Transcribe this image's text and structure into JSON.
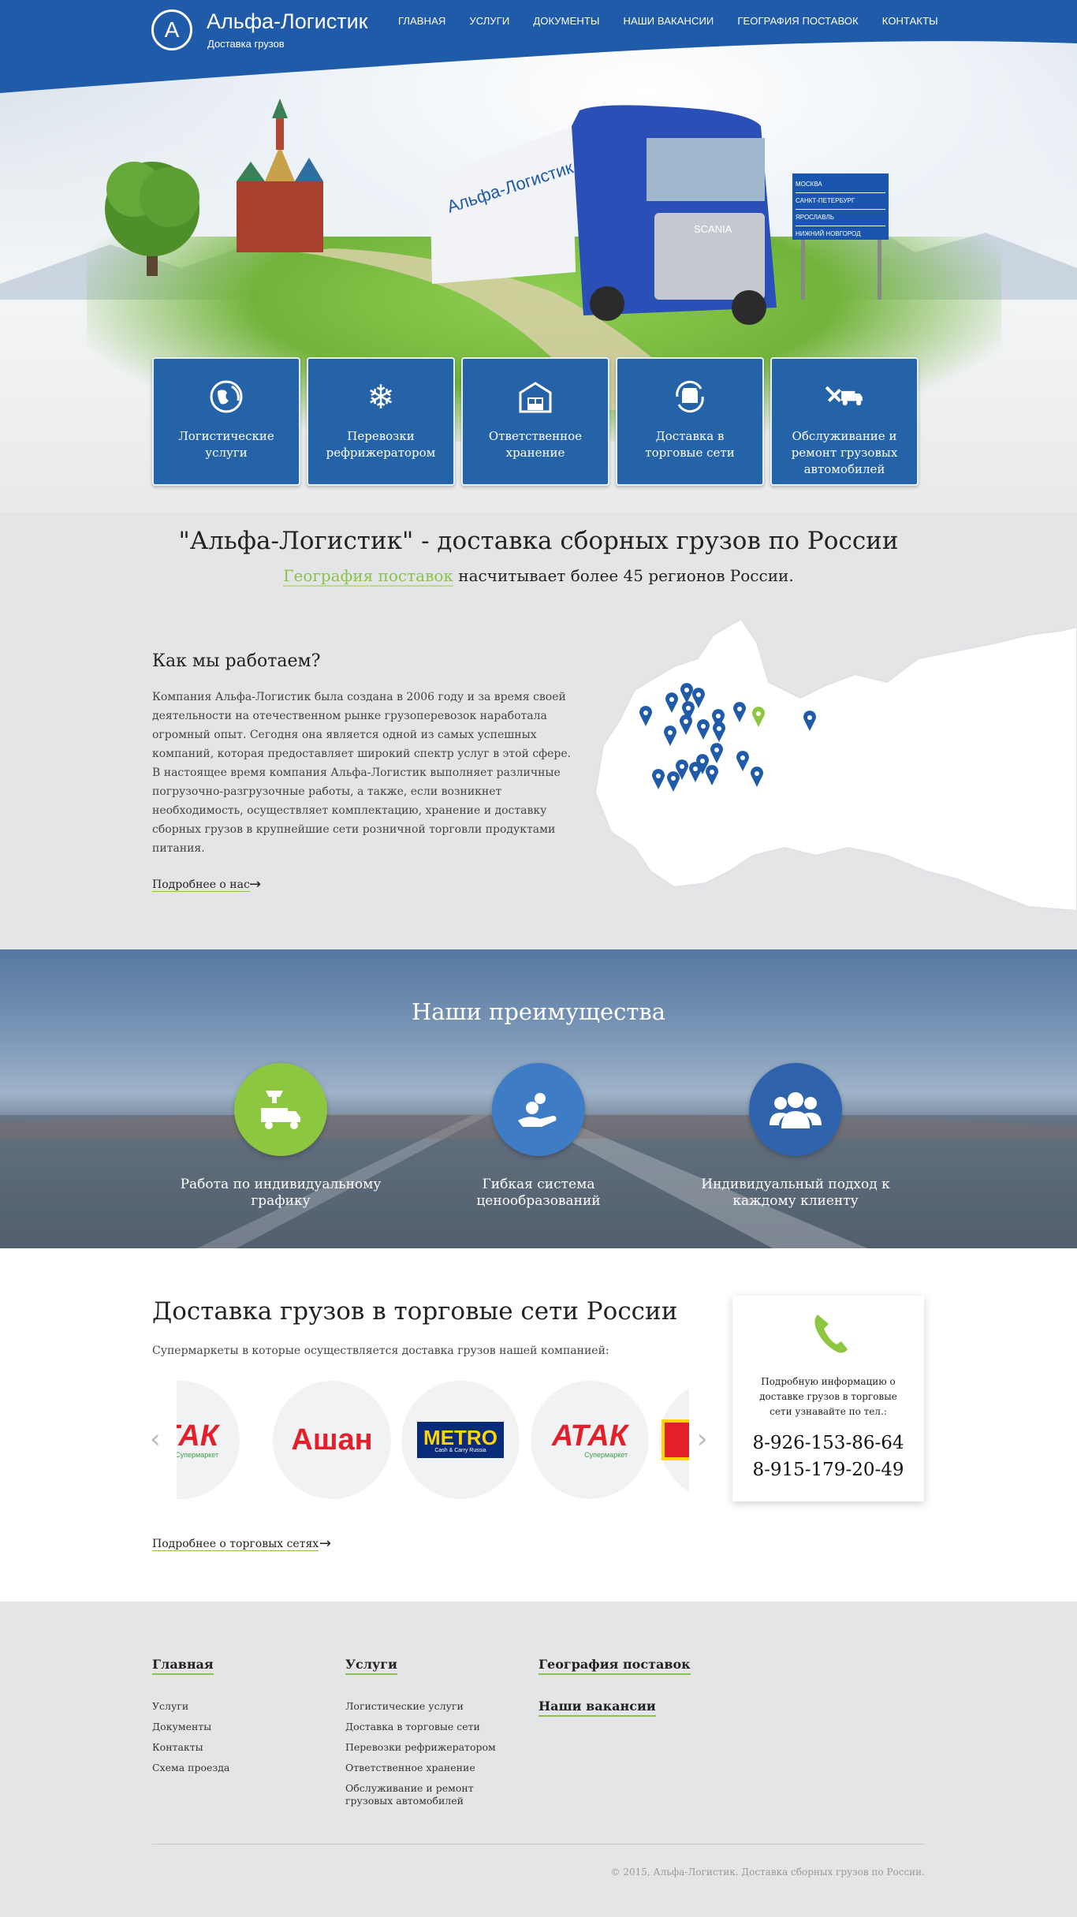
{
  "brand": {
    "name": "Альфа-Логистик",
    "tagline": "Доставка грузов",
    "logo_letter": "A"
  },
  "nav": [
    "ГЛАВНАЯ",
    "УСЛУГИ",
    "ДОКУМЕНТЫ",
    "НАШИ ВАКАНСИИ",
    "ГЕОГРАФИЯ ПОСТАВОК",
    "КОНТАКТЫ"
  ],
  "hero": {
    "truck_brand": "Альфа-Логистик",
    "grille_brand": "SCANIA",
    "signs": [
      "МОСКВА",
      "САНКТ-ПЕТЕРБУРГ",
      "ЯРОСЛАВЛЬ",
      "НИЖНИЙ НОВГОРОД"
    ]
  },
  "services": [
    {
      "label": "Логистические услуги",
      "icon": "globe-icon"
    },
    {
      "label": "Перевозки рефрижератором",
      "icon": "snowflake-icon"
    },
    {
      "label": "Ответственное хранение",
      "icon": "warehouse-icon"
    },
    {
      "label": "Доставка в торговые сети",
      "icon": "store-truck-icon"
    },
    {
      "label": "Обслуживание и ремонт грузовых автомобилей",
      "icon": "repair-truck-icon"
    }
  ],
  "intro": {
    "title": "\"Альфа-Логистик\" - доставка сборных грузов по России",
    "sub_link": "География поставок",
    "sub_rest": " насчитывает более 45 регионов России."
  },
  "how": {
    "title": "Как мы работаем?",
    "text": "Компания Альфа-Логистик была создана в 2006 году и за время своей деятельности на отечественном рынке грузоперевозок наработала огромный опыт. Сегодня она является одной из самых успешных компаний, которая предоставляет широкий спектр услуг в этой сфере. В настоящее время компания Альфа-Логистик выполняет различные погрузочно-разгрузочные работы, а также, если возникнет необходимость, осуществляет комплектацию, хранение и доставку сборных грузов в крупнейшие сети розничной торговли продуктами питания.",
    "more": "Подробнее о нас"
  },
  "advantages": {
    "title": "Наши преимущества",
    "items": [
      {
        "label": "Работа по индивидуальному графику",
        "icon": "schedule-truck-icon",
        "color": "#8dc63f"
      },
      {
        "label": "Гибкая система ценообразований",
        "icon": "money-hand-icon",
        "color": "#3f7cc6"
      },
      {
        "label": "Индивидуальный подход к каждому клиенту",
        "icon": "people-icon",
        "color": "#2f64ad"
      }
    ]
  },
  "retail": {
    "title": "Доставка грузов в торговые сети России",
    "subtitle": "Супермаркеты в которые осуществляется доставка грузов нашей компанией:",
    "logos": [
      {
        "name": "АТАК",
        "caption": "Супермаркет"
      },
      {
        "name": "Ашан"
      },
      {
        "name": "METRO",
        "caption": "Cash & Carry Russia"
      },
      {
        "name": "АТАК",
        "caption": "Супермаркет"
      }
    ],
    "more": "Подробнее о торговых сетях",
    "card_text": "Подробную информацию о доставке грузов в торговые сети узнавайте по тел.:",
    "phones": [
      "8-926-153-86-64",
      "8-915-179-20-49"
    ]
  },
  "footer": {
    "col1": {
      "title": "Главная",
      "items": [
        "Услуги",
        "Документы",
        "Контакты",
        "Схема проезда"
      ]
    },
    "col2": {
      "title": "Услуги",
      "items": [
        "Логистические услуги",
        "Доставка в торговые сети",
        "Перевозки рефрижератором",
        "Ответственное хранение",
        "Обслуживание и ремонт грузовых автомобилей"
      ]
    },
    "col3": {
      "title": "География поставок",
      "title2": "Наши вакансии"
    },
    "copyright": "© 2015, Альфа-Логистик. Доставка сборных грузов по России."
  },
  "colors": {
    "brand_blue": "#2563a8",
    "accent_green": "#8bc34a",
    "header_blue": "#1f5ba8"
  }
}
